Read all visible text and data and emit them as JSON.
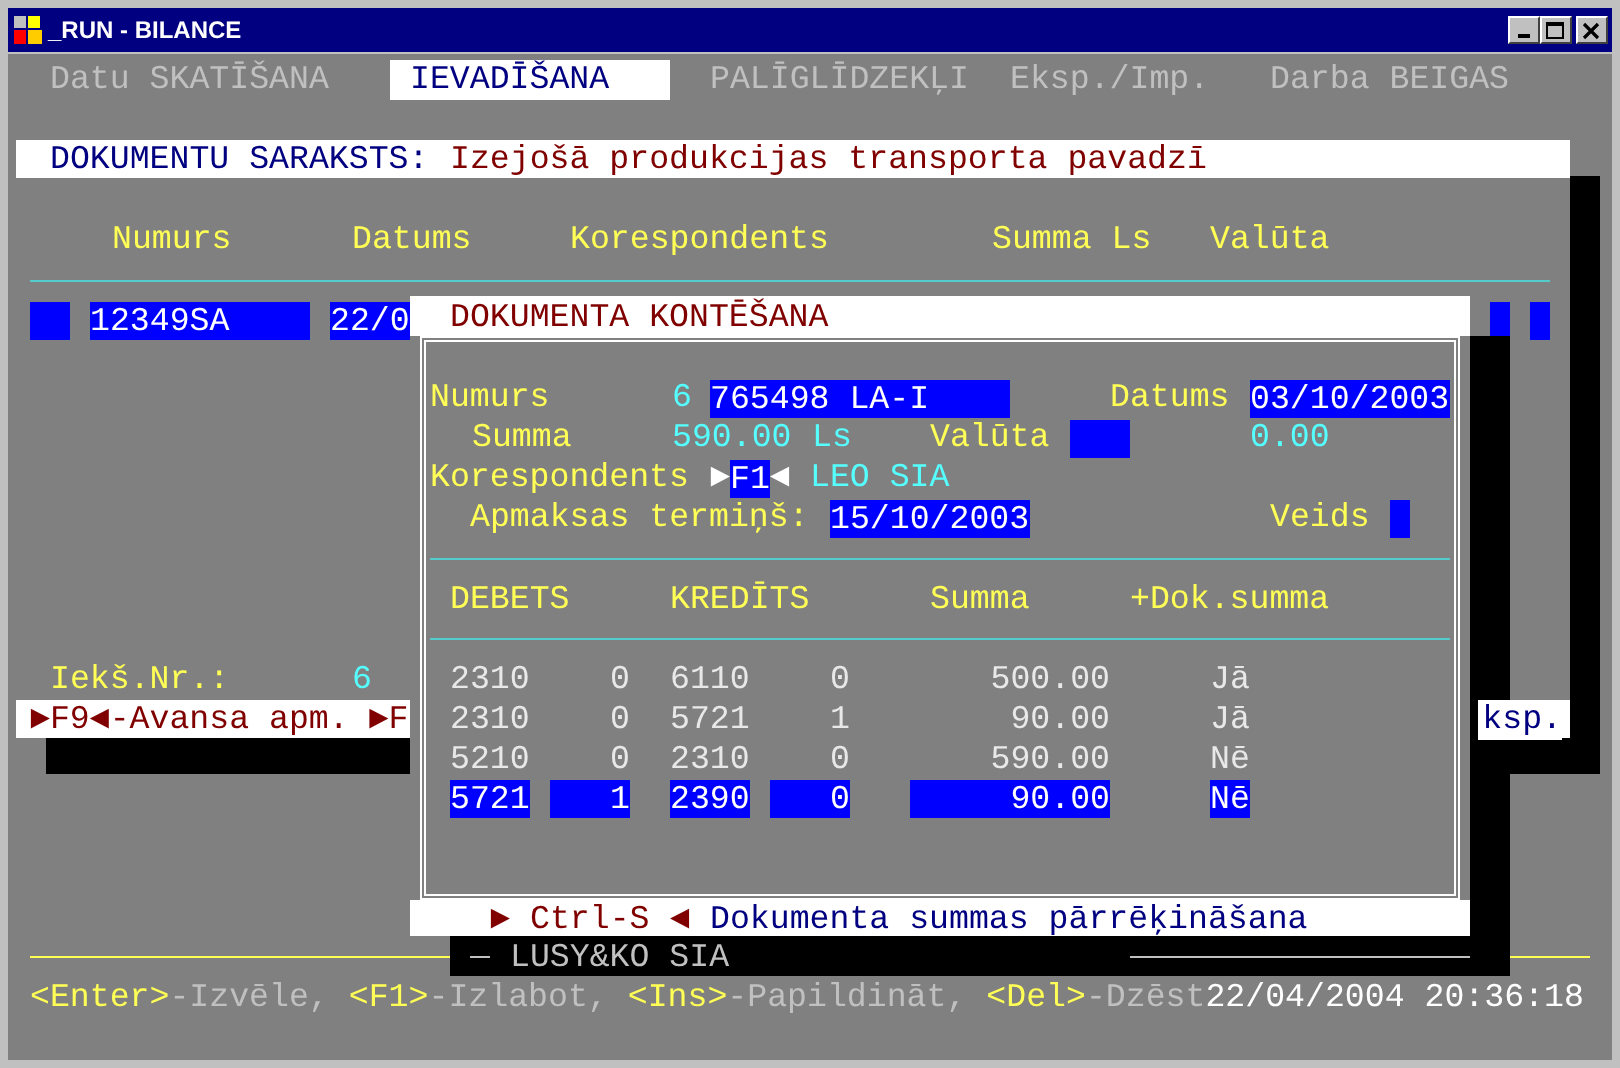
{
  "window": {
    "title": "_RUN - BILANCE"
  },
  "menu": [
    {
      "label": "Datu SKATĪŠANA",
      "selected": false
    },
    {
      "label": "IEVADĪŠANA",
      "selected": true
    },
    {
      "label": "PALĪGLĪDZEKĻI",
      "selected": false
    },
    {
      "label": "Eksp./Imp.",
      "selected": false
    },
    {
      "label": "Darba BEIGAS",
      "selected": false
    }
  ],
  "document_list": {
    "label": "DOKUMENTU SARAKSTS:",
    "name": "Izejošā produkcijas transporta pavadzī",
    "columns": [
      "Numurs",
      "Datums",
      "Korespondents",
      "Summa Ls",
      "Valūta"
    ],
    "row": {
      "number": "12349SA",
      "date": "22/0"
    },
    "internal_number": {
      "label": "Iekš.Nr.:",
      "value": "6"
    },
    "hotkeys": {
      "left": "►F9◄-Avansa apm. ►F",
      "right": "ksp."
    }
  },
  "dialog": {
    "title": "DOKUMENTA KONTĒŠANA",
    "number": {
      "label": "Numurs",
      "prefix": "6",
      "value": "765498 LA-I"
    },
    "date": {
      "label": "Datums",
      "value": "03/10/2003"
    },
    "amount": {
      "label": "Summa",
      "value": "590.00",
      "currency": "Ls"
    },
    "currency": {
      "label": "Valūta",
      "amount": "0.00"
    },
    "correspondent": {
      "label": "Korespondents",
      "key_open": "►",
      "key": "F1",
      "key_close": "◄",
      "name": "LEO SIA"
    },
    "due_date": {
      "label": "Apmaksas termiņš:",
      "value": "15/10/2003"
    },
    "type": {
      "label": "Veids"
    },
    "entries": {
      "columns": [
        "DEBETS",
        "KREDĪTS",
        "Summa",
        "+Dok.summa"
      ],
      "rows": [
        {
          "debit": "2310",
          "debit_sub": "0",
          "credit": "6110",
          "credit_sub": "0",
          "amount": "500.00",
          "add_to_total": "Jā",
          "selected": false
        },
        {
          "debit": "2310",
          "debit_sub": "0",
          "credit": "5721",
          "credit_sub": "1",
          "amount": "90.00",
          "add_to_total": "Jā",
          "selected": false
        },
        {
          "debit": "5210",
          "debit_sub": "0",
          "credit": "2310",
          "credit_sub": "0",
          "amount": "590.00",
          "add_to_total": "Nē",
          "selected": false
        },
        {
          "debit": "5721",
          "debit_sub": "1",
          "credit": "2390",
          "credit_sub": "0",
          "amount": "90.00",
          "add_to_total": "Nē",
          "selected": true
        }
      ]
    },
    "footer": {
      "arrow_left": "►",
      "key": "Ctrl-S",
      "arrow_right": "◄",
      "text": "Dokumenta summas pārrēķināšana"
    }
  },
  "company": "LUSY&KO SIA",
  "status_bar": {
    "shortcuts": [
      {
        "key": "<Enter>",
        "action": "-Izvēle,"
      },
      {
        "key": "<F1>",
        "action": "-Izlabot,"
      },
      {
        "key": "<Ins>",
        "action": "-Papildināt,"
      },
      {
        "key": "<Del>",
        "action": "-Dzēst"
      }
    ],
    "datetime": "22/04/2004 20:36:18"
  }
}
